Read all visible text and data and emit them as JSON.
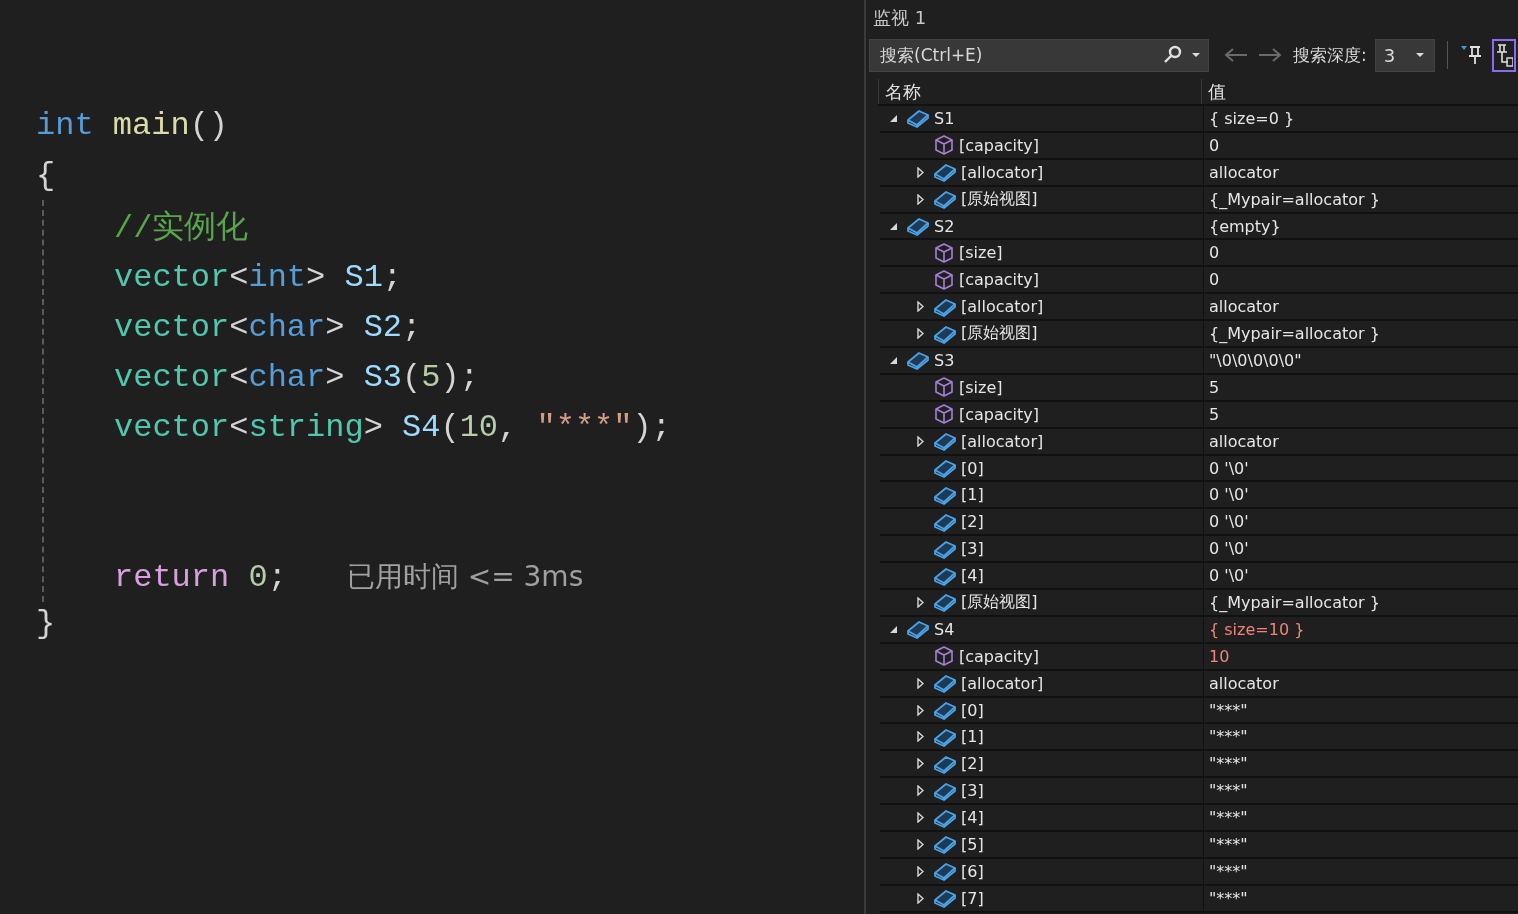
{
  "editor": {
    "header": [
      {
        "kind": "keyword",
        "text": "int"
      },
      {
        "kind": "space"
      },
      {
        "kind": "function",
        "text": "main"
      },
      {
        "kind": "punct",
        "text": "()"
      }
    ],
    "open": [
      {
        "kind": "punct",
        "text": "{"
      }
    ],
    "body": [
      [
        {
          "kind": "comment",
          "text": "//实例化"
        }
      ],
      [
        {
          "kind": "type",
          "text": "vector"
        },
        {
          "kind": "punct",
          "text": "<"
        },
        {
          "kind": "keyword",
          "text": "int"
        },
        {
          "kind": "punct",
          "text": ">"
        },
        {
          "kind": "space"
        },
        {
          "kind": "variable",
          "text": "S1"
        },
        {
          "kind": "punct",
          "text": ";"
        }
      ],
      [
        {
          "kind": "type",
          "text": "vector"
        },
        {
          "kind": "punct",
          "text": "<"
        },
        {
          "kind": "keyword",
          "text": "char"
        },
        {
          "kind": "punct",
          "text": ">"
        },
        {
          "kind": "space"
        },
        {
          "kind": "variable",
          "text": "S2"
        },
        {
          "kind": "punct",
          "text": ";"
        }
      ],
      [
        {
          "kind": "type",
          "text": "vector"
        },
        {
          "kind": "punct",
          "text": "<"
        },
        {
          "kind": "keyword",
          "text": "char"
        },
        {
          "kind": "punct",
          "text": ">"
        },
        {
          "kind": "space"
        },
        {
          "kind": "variable",
          "text": "S3"
        },
        {
          "kind": "punct",
          "text": "("
        },
        {
          "kind": "number",
          "text": "5"
        },
        {
          "kind": "punct",
          "text": ");"
        }
      ],
      [
        {
          "kind": "type",
          "text": "vector"
        },
        {
          "kind": "punct",
          "text": "<"
        },
        {
          "kind": "type",
          "text": "string"
        },
        {
          "kind": "punct",
          "text": ">"
        },
        {
          "kind": "space"
        },
        {
          "kind": "variable",
          "text": "S4"
        },
        {
          "kind": "punct",
          "text": "("
        },
        {
          "kind": "number",
          "text": "10"
        },
        {
          "kind": "punct",
          "text": ", "
        },
        {
          "kind": "string",
          "text": "\"***\""
        },
        {
          "kind": "punct",
          "text": ");"
        }
      ]
    ],
    "tail": {
      "tokens": [
        {
          "kind": "control",
          "text": "return"
        },
        {
          "kind": "space"
        },
        {
          "kind": "number",
          "text": "0"
        },
        {
          "kind": "punct",
          "text": ";"
        }
      ],
      "hint": "已用时间 <= 3ms"
    },
    "close": [
      {
        "kind": "punct",
        "text": "}"
      }
    ]
  },
  "watch": {
    "title": "监视 1",
    "search": {
      "placeholder": "搜索(Ctrl+E)"
    },
    "depth_label": "搜索深度:",
    "depth_value": "3",
    "columns": [
      "名称",
      "值"
    ],
    "rows": [
      {
        "name": "S1",
        "value": "{ size=0 }",
        "kind": "object",
        "expanded": true,
        "changed": false,
        "children": [
          {
            "name": "[capacity]",
            "value": "0",
            "kind": "field",
            "changed": false
          },
          {
            "name": "[allocator]",
            "value": "allocator",
            "kind": "object",
            "expanded": false,
            "changed": false
          },
          {
            "name": "[原始视图]",
            "value": "{_Mypair=allocator }",
            "kind": "object",
            "expanded": false,
            "changed": false
          }
        ]
      },
      {
        "name": "S2",
        "value": "{empty}",
        "kind": "object",
        "expanded": true,
        "changed": false,
        "children": [
          {
            "name": "[size]",
            "value": "0",
            "kind": "field",
            "changed": false
          },
          {
            "name": "[capacity]",
            "value": "0",
            "kind": "field",
            "changed": false
          },
          {
            "name": "[allocator]",
            "value": "allocator",
            "kind": "object",
            "expanded": false,
            "changed": false
          },
          {
            "name": "[原始视图]",
            "value": "{_Mypair=allocator }",
            "kind": "object",
            "expanded": false,
            "changed": false
          }
        ]
      },
      {
        "name": "S3",
        "value": "\"\\0\\0\\0\\0\\0\"",
        "kind": "object",
        "expanded": true,
        "changed": false,
        "children": [
          {
            "name": "[size]",
            "value": "5",
            "kind": "field",
            "changed": false
          },
          {
            "name": "[capacity]",
            "value": "5",
            "kind": "field",
            "changed": false
          },
          {
            "name": "[allocator]",
            "value": "allocator",
            "kind": "object",
            "expanded": false,
            "changed": false
          },
          {
            "name": "[0]",
            "value": "0 '\\0'",
            "kind": "object",
            "changed": false
          },
          {
            "name": "[1]",
            "value": "0 '\\0'",
            "kind": "object",
            "changed": false
          },
          {
            "name": "[2]",
            "value": "0 '\\0'",
            "kind": "object",
            "changed": false
          },
          {
            "name": "[3]",
            "value": "0 '\\0'",
            "kind": "object",
            "changed": false
          },
          {
            "name": "[4]",
            "value": "0 '\\0'",
            "kind": "object",
            "changed": false
          },
          {
            "name": "[原始视图]",
            "value": "{_Mypair=allocator }",
            "kind": "object",
            "expanded": false,
            "changed": false
          }
        ]
      },
      {
        "name": "S4",
        "value": "{ size=10 }",
        "kind": "object",
        "expanded": true,
        "changed": true,
        "children": [
          {
            "name": "[capacity]",
            "value": "10",
            "kind": "field",
            "changed": true
          },
          {
            "name": "[allocator]",
            "value": "allocator",
            "kind": "object",
            "expanded": false,
            "changed": false
          },
          {
            "name": "[0]",
            "value": "\"***\"",
            "kind": "object",
            "expanded": false,
            "changed": false
          },
          {
            "name": "[1]",
            "value": "\"***\"",
            "kind": "object",
            "expanded": false,
            "changed": false
          },
          {
            "name": "[2]",
            "value": "\"***\"",
            "kind": "object",
            "expanded": false,
            "changed": false
          },
          {
            "name": "[3]",
            "value": "\"***\"",
            "kind": "object",
            "expanded": false,
            "changed": false
          },
          {
            "name": "[4]",
            "value": "\"***\"",
            "kind": "object",
            "expanded": false,
            "changed": false
          },
          {
            "name": "[5]",
            "value": "\"***\"",
            "kind": "object",
            "expanded": false,
            "changed": false
          },
          {
            "name": "[6]",
            "value": "\"***\"",
            "kind": "object",
            "expanded": false,
            "changed": false
          },
          {
            "name": "[7]",
            "value": "\"***\"",
            "kind": "object",
            "expanded": false,
            "changed": false
          }
        ]
      }
    ]
  }
}
